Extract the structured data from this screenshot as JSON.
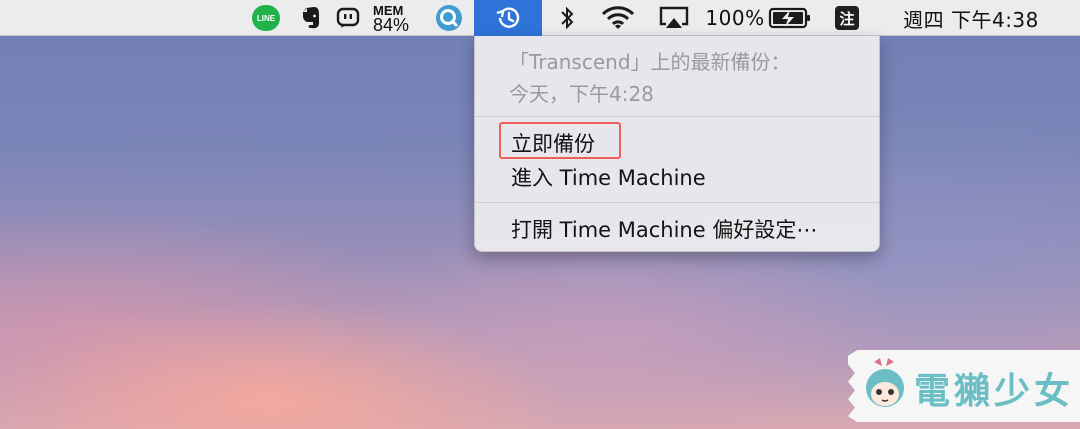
{
  "menubar": {
    "line_label": "LINE",
    "mem_label": "MEM",
    "mem_value": "84%",
    "battery_percent": "100%",
    "input_method": "注",
    "clock": "週四 下午4:38",
    "colors": {
      "bar_bg": "#ececec",
      "active_bg": "#2f73d9",
      "line_green": "#22b24c"
    },
    "icons": [
      "line-icon",
      "evernote-icon",
      "chat-app-icon",
      "mem-monitor",
      "search-app-icon",
      "time-machine-icon",
      "bluetooth-icon",
      "wifi-icon",
      "airplay-icon",
      "battery-icon",
      "input-method-icon",
      "clock"
    ]
  },
  "dropdown": {
    "status_line1": "「Transcend」上的最新備份：",
    "status_line2": "今天，下午4:28",
    "items": [
      {
        "label": "立即備份"
      },
      {
        "label": "進入 Time Machine"
      },
      {
        "label": "打開 Time Machine 偏好設定⋯"
      }
    ],
    "highlight_color": "#ee5f5b"
  },
  "watermark": {
    "text": "電獺少女",
    "color": "#6bbfc4"
  }
}
